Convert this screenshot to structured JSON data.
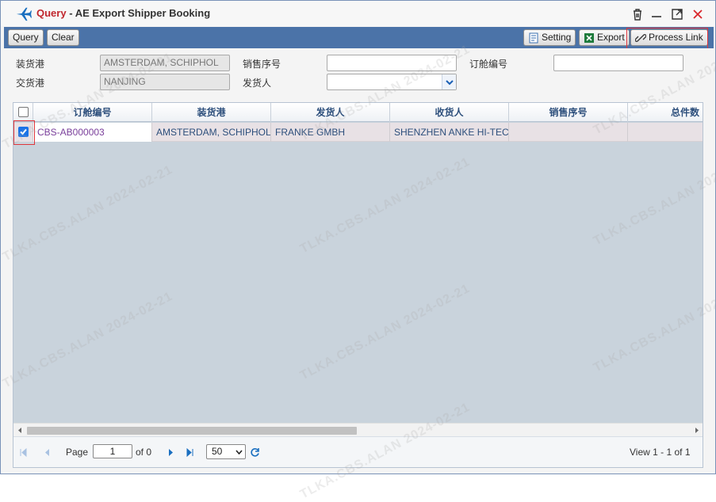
{
  "window": {
    "title_query": "Query",
    "title_sep": "-",
    "title_name": "AE Export Shipper Booking"
  },
  "toolbar": {
    "query_label": "Query",
    "clear_label": "Clear",
    "setting_label": "Setting",
    "export_label": "Export",
    "process_link_label": "Process Link"
  },
  "form": {
    "loading_port_label": "装货港",
    "loading_port_value": "AMSTERDAM, SCHIPHOL",
    "delivery_port_label": "交货港",
    "delivery_port_value": "NANJING",
    "sales_no_label": "销售序号",
    "sales_no_value": "",
    "shipper_label": "发货人",
    "shipper_value": "",
    "booking_no_label": "订舱编号",
    "booking_no_value": ""
  },
  "grid": {
    "columns": [
      "订舱编号",
      "装货港",
      "发货人",
      "收货人",
      "销售序号",
      "总件数"
    ],
    "rows": [
      {
        "checked": true,
        "booking_no": "CBS-AB000003",
        "loading_port": "AMSTERDAM, SCHIPHOL",
        "shipper": "FRANKE GMBH",
        "consignee": "SHENZHEN ANKE HI-TEC",
        "sales_no": "",
        "total_pieces": ""
      }
    ]
  },
  "pager": {
    "page_label": "Page",
    "page_value": "1",
    "of_label": "of 0",
    "page_size": "50",
    "view_text": "View 1 - 1 of 1"
  },
  "watermark_text": "TLKA.CBS.ALAN 2024-02-21",
  "colors": {
    "accent": "#4b73a8",
    "title_red": "#c0262d",
    "highlight": "#e0353b",
    "checkbox_blue": "#1a73e8",
    "link_purple": "#7a3f9b"
  },
  "icons": [
    "airplane-icon",
    "trash-icon",
    "minimize-icon",
    "maximize-icon",
    "close-icon",
    "setting-icon",
    "excel-icon",
    "link-icon",
    "first-page-icon",
    "prev-page-icon",
    "next-page-icon",
    "last-page-icon",
    "refresh-icon"
  ]
}
